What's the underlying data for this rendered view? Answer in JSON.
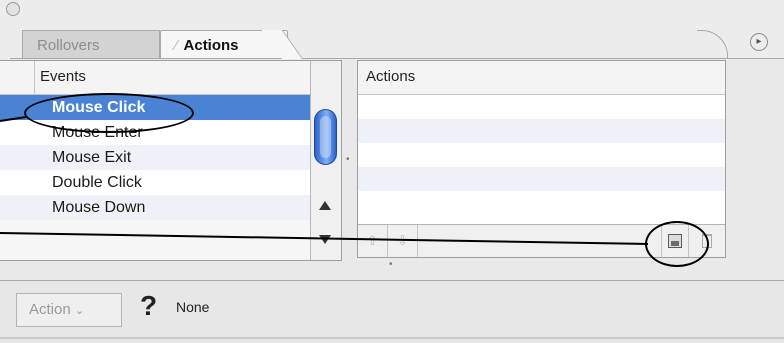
{
  "tabs": {
    "rollovers": "Rollovers",
    "actions": "Actions"
  },
  "events": {
    "header": "Events",
    "items": [
      {
        "label": "Mouse Click",
        "selected": true
      },
      {
        "label": "Mouse Enter",
        "selected": false
      },
      {
        "label": "Mouse Exit",
        "selected": false
      },
      {
        "label": "Double Click",
        "selected": false
      },
      {
        "label": "Mouse Down",
        "selected": false
      }
    ]
  },
  "actions_list": {
    "header": "Actions"
  },
  "footer": {
    "action_button": "Action",
    "help_glyph": "?",
    "status": "None"
  },
  "colors": {
    "selection": "#4a83d3",
    "callout": "#000000"
  }
}
